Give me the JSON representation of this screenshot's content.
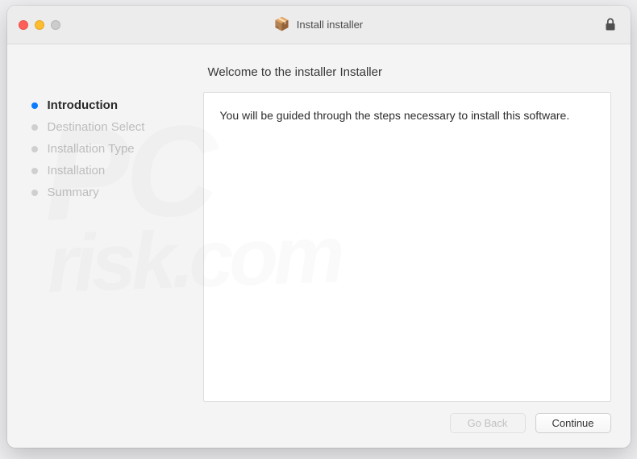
{
  "titlebar": {
    "title": "Install installer"
  },
  "sidebar": {
    "steps": [
      {
        "label": "Introduction",
        "active": true
      },
      {
        "label": "Destination Select",
        "active": false
      },
      {
        "label": "Installation Type",
        "active": false
      },
      {
        "label": "Installation",
        "active": false
      },
      {
        "label": "Summary",
        "active": false
      }
    ]
  },
  "main": {
    "heading": "Welcome to the installer Installer",
    "body_text": "You will be guided through the steps necessary to install this software."
  },
  "buttons": {
    "go_back": "Go Back",
    "continue": "Continue"
  },
  "watermark": {
    "line1": "PC",
    "line2": "risk.com"
  }
}
